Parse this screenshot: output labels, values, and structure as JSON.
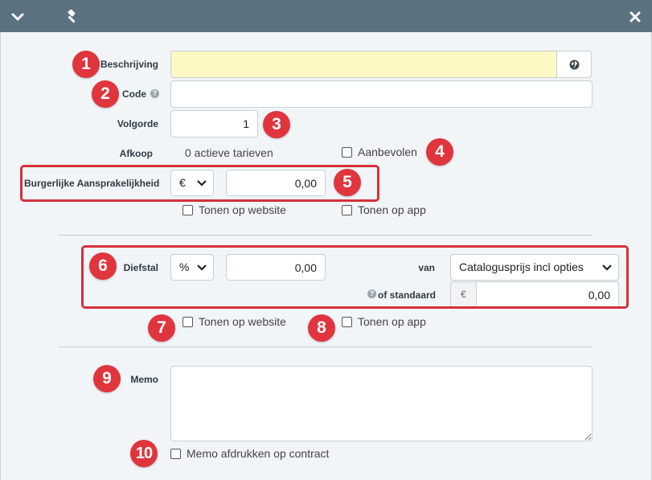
{
  "toolbar": {
    "collapse_icon": "chevron-down-icon",
    "tool_icon": "gavel-icon",
    "close_icon": "close-icon"
  },
  "colors": {
    "topbar": "#5a7180",
    "panel": "#f1f5f7",
    "highlight_input": "#fdf8c4",
    "annotation_red": "#e0353d",
    "divider": "#b9d3d6"
  },
  "form": {
    "description": {
      "label": "Beschrijving",
      "value": "",
      "globe_icon": "globe-icon"
    },
    "code": {
      "label": "Code",
      "value": ""
    },
    "order": {
      "label": "Volgorde",
      "value": "1"
    },
    "buyout": {
      "label": "Afkoop",
      "status": "0 actieve tarieven"
    },
    "recommended": {
      "label": "Aanbevolen",
      "checked": false
    },
    "liability": {
      "label": "Burgerlijke Aansprakelijkheid",
      "unit": "€",
      "amount": "0,00",
      "show_website": "Tonen op website",
      "show_app": "Tonen op app"
    },
    "theft": {
      "label": "Diefstal",
      "unit": "%",
      "amount": "0,00",
      "from_label": "van",
      "from_value": "Catalogusprijs incl opties",
      "standard_label": "of standaard",
      "currency": "€",
      "standard_amount": "0,00",
      "show_website": "Tonen op website",
      "show_app": "Tonen op app"
    },
    "memo": {
      "label": "Memo",
      "value": "",
      "print_label": "Memo afdrukken op contract"
    }
  },
  "annotations": [
    "1",
    "2",
    "3",
    "4",
    "5",
    "6",
    "7",
    "8",
    "9",
    "10"
  ]
}
